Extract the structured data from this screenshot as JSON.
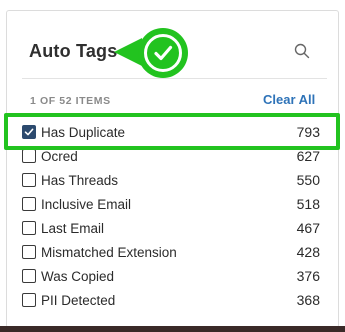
{
  "panel": {
    "title": "Auto Tags",
    "count_label": "1 OF 52 ITEMS",
    "clear_all_label": "Clear All"
  },
  "tags": [
    {
      "label": "Has Duplicate",
      "count": "793",
      "checked": true
    },
    {
      "label": "Ocred",
      "count": "627",
      "checked": false
    },
    {
      "label": "Has Threads",
      "count": "550",
      "checked": false
    },
    {
      "label": "Inclusive Email",
      "count": "518",
      "checked": false
    },
    {
      "label": "Last Email",
      "count": "467",
      "checked": false
    },
    {
      "label": "Mismatched Extension",
      "count": "428",
      "checked": false
    },
    {
      "label": "Was Copied",
      "count": "376",
      "checked": false
    },
    {
      "label": "PII Detected",
      "count": "368",
      "checked": false
    }
  ],
  "colors": {
    "highlight": "#22c31f",
    "link": "#2e73b8",
    "checked_box": "#2c4a6e"
  },
  "icons": {
    "search": "search-icon",
    "callout": "checkmark-icon"
  }
}
